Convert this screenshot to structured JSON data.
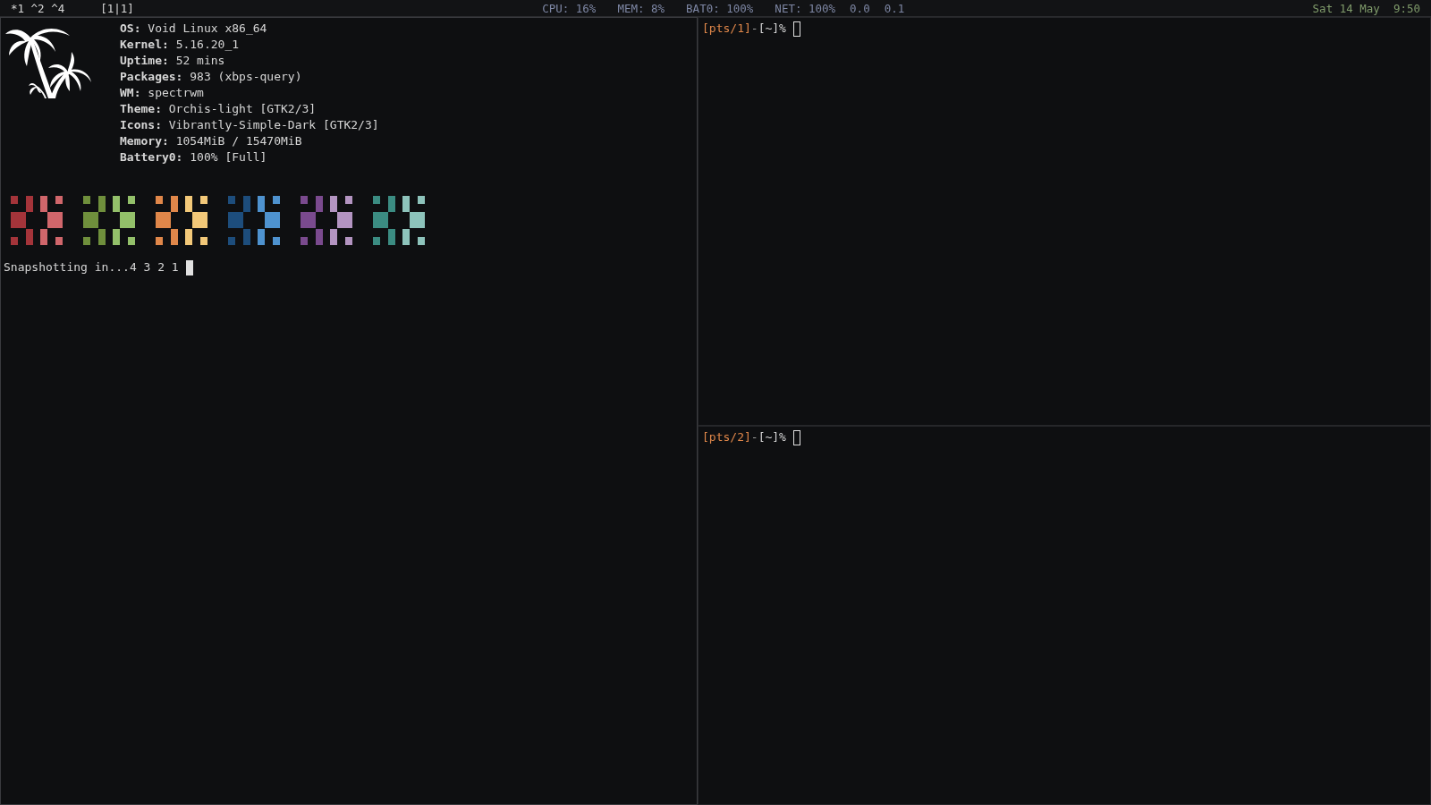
{
  "status_bar": {
    "workspaces": "*1 ^2 ^4",
    "layout": "[1|1]",
    "stats": [
      "CPU: 16%",
      "MEM: 8%",
      "BAT0: 100%",
      "NET: 100%",
      "0.0",
      "0.1"
    ],
    "clock": "Sat 14 May  9:50"
  },
  "panes": [
    {
      "focused": true,
      "info": [
        {
          "label": "OS:",
          "value": "Void Linux x86_64"
        },
        {
          "label": "Kernel:",
          "value": "5.16.20_1"
        },
        {
          "label": "Uptime:",
          "value": "52 mins"
        },
        {
          "label": "Packages:",
          "value": "983 (xbps-query)"
        },
        {
          "label": "WM:",
          "value": "spectrwm"
        },
        {
          "label": "Theme:",
          "value": "Orchis-light [GTK2/3]"
        },
        {
          "label": "Icons:",
          "value": "Vibrantly-Simple-Dark [GTK2/3]"
        },
        {
          "label": "Memory:",
          "value": "1054MiB / 15470MiB"
        },
        {
          "label": "Battery0:",
          "value": "100% [Full]"
        }
      ],
      "palette": [
        {
          "shades": [
            {
              "color": "#a4343a"
            },
            {
              "color": "#d0666b"
            }
          ]
        },
        {
          "shades": [
            {
              "color": "#6f8f3c"
            },
            {
              "color": "#93c06a"
            }
          ]
        },
        {
          "shades": [
            {
              "color": "#e0874a"
            },
            {
              "color": "#f2c879"
            }
          ]
        },
        {
          "shades": [
            {
              "color": "#1d4d7c"
            },
            {
              "color": "#4e92cf"
            }
          ]
        },
        {
          "shades": [
            {
              "color": "#7a4a8e"
            },
            {
              "color": "#b394c1"
            }
          ]
        },
        {
          "shades": [
            {
              "color": "#3b8c82"
            },
            {
              "color": "#8dc3bb"
            }
          ]
        }
      ],
      "output": "Snapshotting in...4 3 2 1"
    },
    {
      "focused": false,
      "prompt": {
        "tty": "[pts/1]",
        "sep": "-",
        "dir": "[~]%"
      }
    },
    {
      "focused": false,
      "prompt": {
        "tty": "[pts/2]",
        "sep": "-",
        "dir": "[~]%"
      }
    }
  ]
}
